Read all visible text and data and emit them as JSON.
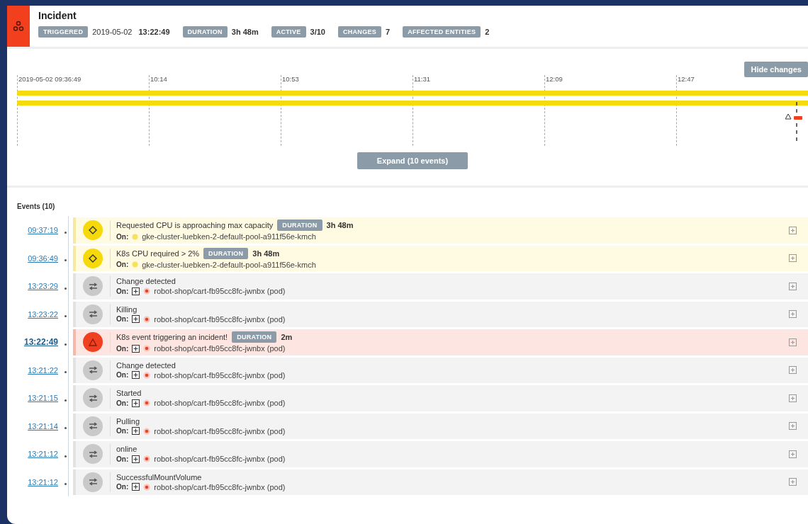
{
  "header": {
    "title": "Incident",
    "stats": [
      {
        "label": "TRIGGERED",
        "date": "2019-05-02",
        "value": "13:22:49"
      },
      {
        "label": "DURATION",
        "value": "3h 48m"
      },
      {
        "label": "ACTIVE",
        "value": "3/10"
      },
      {
        "label": "CHANGES",
        "value": "7"
      },
      {
        "label": "AFFECTED ENTITIES",
        "value": "2"
      }
    ]
  },
  "timeline": {
    "hide_button": "Hide changes",
    "ticks": [
      "2019-05-02 09:36:49",
      "10:14",
      "10:53",
      "11:31",
      "12:09",
      "12:47"
    ],
    "expand_button": "Expand (10 events)"
  },
  "events": {
    "title": "Events (10)",
    "rows": [
      {
        "time": "09:37:19",
        "selected": false,
        "kind": "warning",
        "title": "Requested CPU is approaching max capacity",
        "duration_label": "DURATION",
        "duration": "3h 48m",
        "on_label": "On:",
        "entity": {
          "kind": "node",
          "name": "gke-cluster-luebken-2-default-pool-a911f56e-kmch"
        }
      },
      {
        "time": "09:36:49",
        "selected": false,
        "kind": "warning",
        "title": "K8s CPU required > 2%",
        "duration_label": "DURATION",
        "duration": "3h 48m",
        "on_label": "On:",
        "entity": {
          "kind": "node",
          "name": "gke-cluster-luebken-2-default-pool-a911f56e-kmch"
        }
      },
      {
        "time": "13:23:29",
        "selected": false,
        "kind": "change",
        "title": "Change detected",
        "on_label": "On:",
        "entity": {
          "kind": "pod",
          "name": "robot-shop/cart-fb95cc8fc-jwnbx (pod)"
        }
      },
      {
        "time": "13:23:22",
        "selected": false,
        "kind": "change",
        "title": "Killing",
        "on_label": "On:",
        "entity": {
          "kind": "pod",
          "name": "robot-shop/cart-fb95cc8fc-jwnbx (pod)"
        }
      },
      {
        "time": "13:22:49",
        "selected": true,
        "kind": "incident",
        "title": "K8s event triggering an incident!",
        "duration_label": "DURATION",
        "duration": "2m",
        "on_label": "On:",
        "entity": {
          "kind": "pod",
          "name": "robot-shop/cart-fb95cc8fc-jwnbx (pod)"
        }
      },
      {
        "time": "13:21:22",
        "selected": false,
        "kind": "change",
        "title": "Change detected",
        "on_label": "On:",
        "entity": {
          "kind": "pod",
          "name": "robot-shop/cart-fb95cc8fc-jwnbx (pod)"
        }
      },
      {
        "time": "13:21:15",
        "selected": false,
        "kind": "change",
        "title": "Started",
        "on_label": "On:",
        "entity": {
          "kind": "pod",
          "name": "robot-shop/cart-fb95cc8fc-jwnbx (pod)"
        }
      },
      {
        "time": "13:21:14",
        "selected": false,
        "kind": "change",
        "title": "Pulling",
        "on_label": "On:",
        "entity": {
          "kind": "pod",
          "name": "robot-shop/cart-fb95cc8fc-jwnbx (pod)"
        }
      },
      {
        "time": "13:21:12",
        "selected": false,
        "kind": "change",
        "title": "online",
        "on_label": "On:",
        "entity": {
          "kind": "pod",
          "name": "robot-shop/cart-fb95cc8fc-jwnbx (pod)"
        }
      },
      {
        "time": "13:21:12",
        "selected": false,
        "kind": "change",
        "title": "SuccessfulMountVolume",
        "on_label": "On:",
        "entity": {
          "kind": "pod",
          "name": "robot-shop/cart-fb95cc8fc-jwnbx (pod)"
        }
      }
    ]
  }
}
